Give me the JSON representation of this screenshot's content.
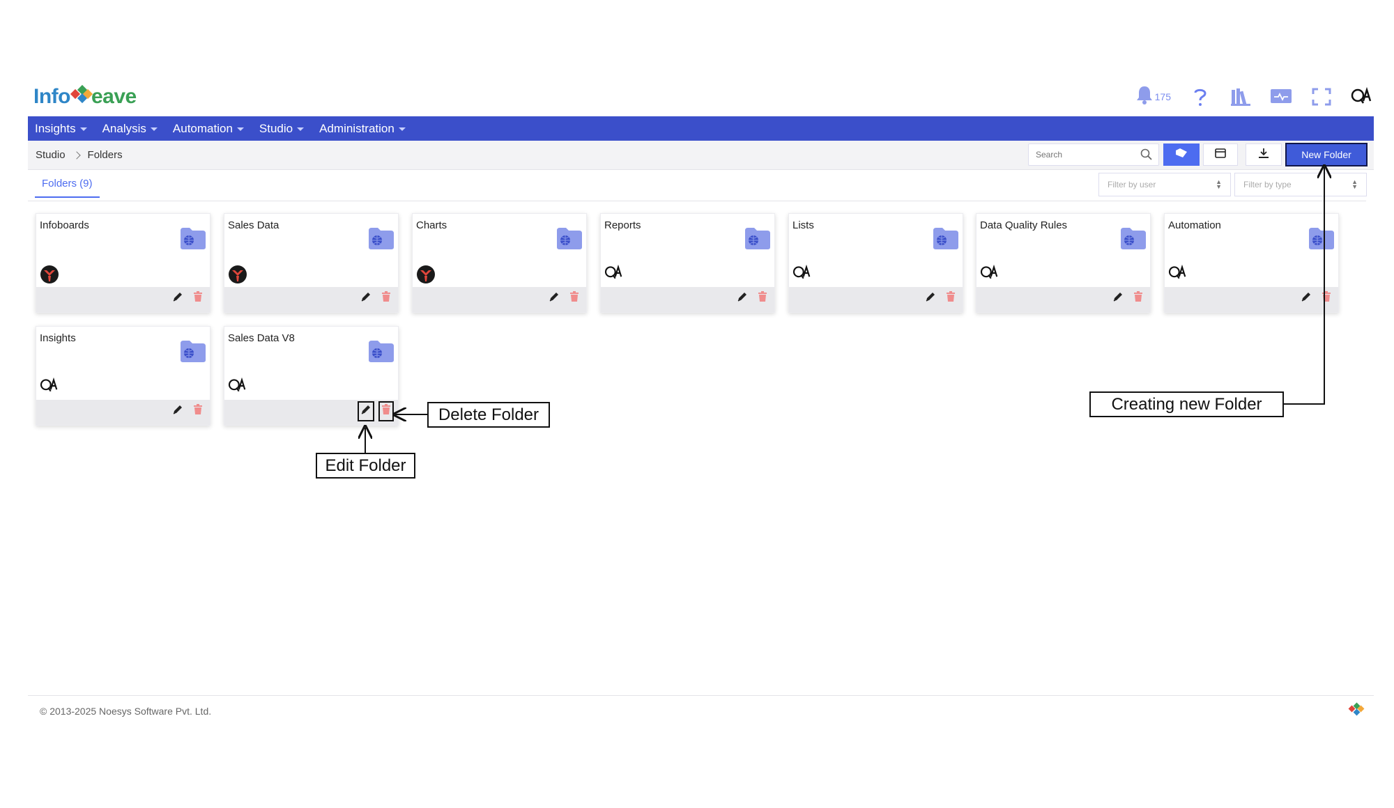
{
  "header": {
    "logo_prefix": "Info",
    "logo_suffix": "eave",
    "notification_count": "175"
  },
  "nav": {
    "items": [
      {
        "label": "Insights"
      },
      {
        "label": "Analysis"
      },
      {
        "label": "Automation"
      },
      {
        "label": "Studio"
      },
      {
        "label": "Administration"
      }
    ]
  },
  "breadcrumb": {
    "root": "Studio",
    "current": "Folders"
  },
  "toolbar": {
    "search_placeholder": "Search",
    "new_folder_label": "New Folder"
  },
  "tabs": {
    "folders_label": "Folders (9)"
  },
  "filters": {
    "user_placeholder": "Filter by user",
    "type_placeholder": "Filter by type"
  },
  "folders": [
    {
      "title": "Infoboards",
      "owner": "logo-avatar"
    },
    {
      "title": "Sales Data",
      "owner": "logo-avatar"
    },
    {
      "title": "Charts",
      "owner": "logo-avatar"
    },
    {
      "title": "Reports",
      "owner": "qa-avatar"
    },
    {
      "title": "Lists",
      "owner": "qa-avatar"
    },
    {
      "title": "Data Quality Rules",
      "owner": "qa-avatar"
    },
    {
      "title": "Automation",
      "owner": "qa-avatar"
    },
    {
      "title": "Insights",
      "owner": "qa-avatar"
    },
    {
      "title": "Sales Data V8",
      "owner": "qa-avatar"
    }
  ],
  "annotations": {
    "delete_folder": "Delete Folder",
    "edit_folder": "Edit Folder",
    "create_folder": "Creating new Folder"
  },
  "footer": {
    "copyright": "© 2013-2025 Noesys Software Pvt. Ltd."
  },
  "colors": {
    "nav_bg": "#3b4fca",
    "accent": "#4d6cf0",
    "folder_icon": "#8e9ceb",
    "delete_icon": "#f08c8c"
  }
}
